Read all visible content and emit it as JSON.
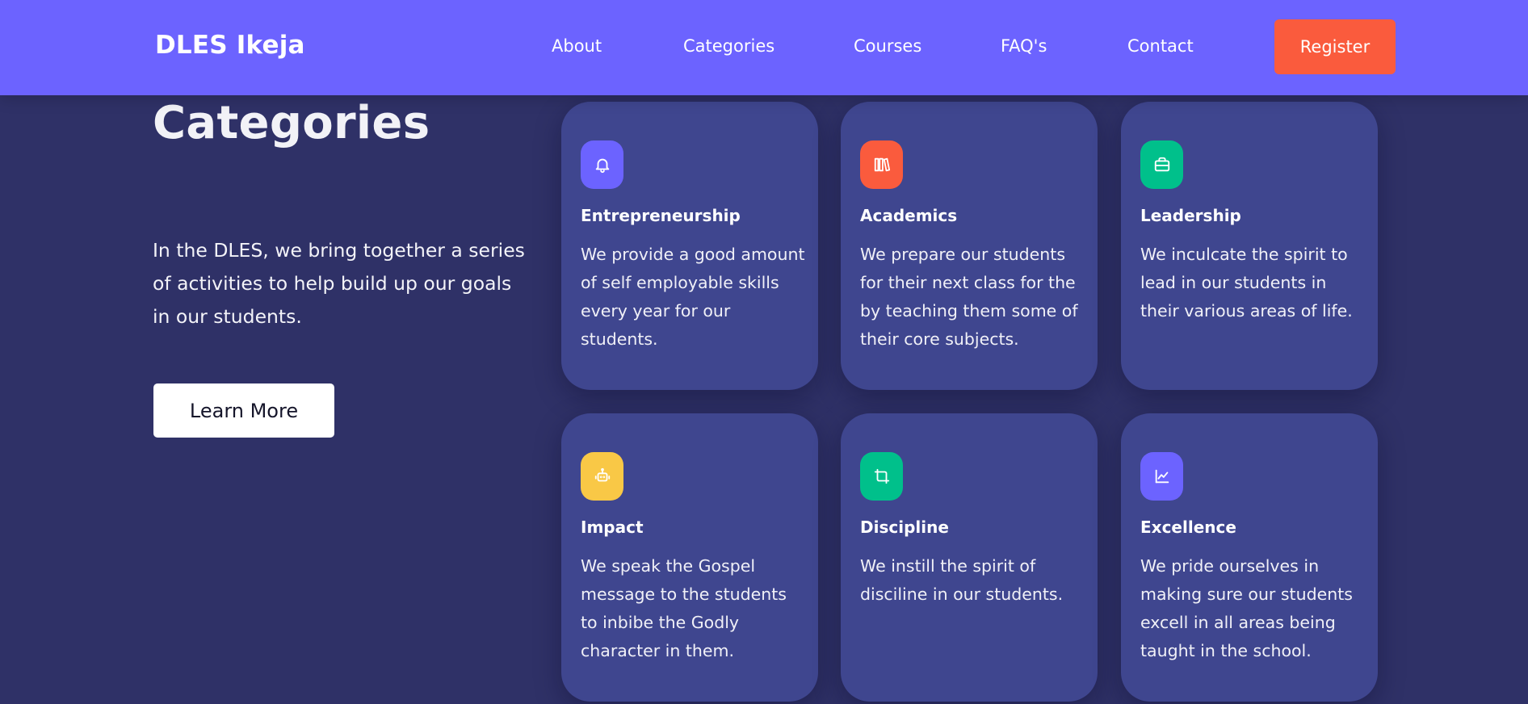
{
  "header": {
    "brand": "DLES Ikeja",
    "nav": [
      "About",
      "Categories",
      "Courses",
      "FAQ's",
      "Contact"
    ],
    "register_label": "Register"
  },
  "intro": {
    "title": "Categories",
    "text": "In the DLES, we bring together a series of activities to help build up our goals in our students.",
    "learn_more_label": "Learn More"
  },
  "cards": [
    {
      "title": "Entrepreneurship",
      "text": "We provide a good amount of self employable skills every year for our students.",
      "icon": "bell-icon",
      "color": "#6c63ff"
    },
    {
      "title": "Academics",
      "text": "We prepare our students for their next class for the by teaching them some of their core subjects.",
      "icon": "books-icon",
      "color": "#fa5b3d"
    },
    {
      "title": "Leadership",
      "text": "We inculcate the spirit to lead in our students in their various areas of life.",
      "icon": "briefcase-icon",
      "color": "#00c08b"
    },
    {
      "title": "Impact",
      "text": "We speak the Gospel message to the students to inbibe the Godly character in them.",
      "icon": "robot-icon",
      "color": "#f9c846"
    },
    {
      "title": "Discipline",
      "text": "We instill the spirit of disciline in our students.",
      "icon": "crop-icon",
      "color": "#00c08b"
    },
    {
      "title": "Excellence",
      "text": "We pride ourselves in making sure our students excell in all areas being taught in the school.",
      "icon": "chart-icon",
      "color": "#6c63ff"
    }
  ]
}
